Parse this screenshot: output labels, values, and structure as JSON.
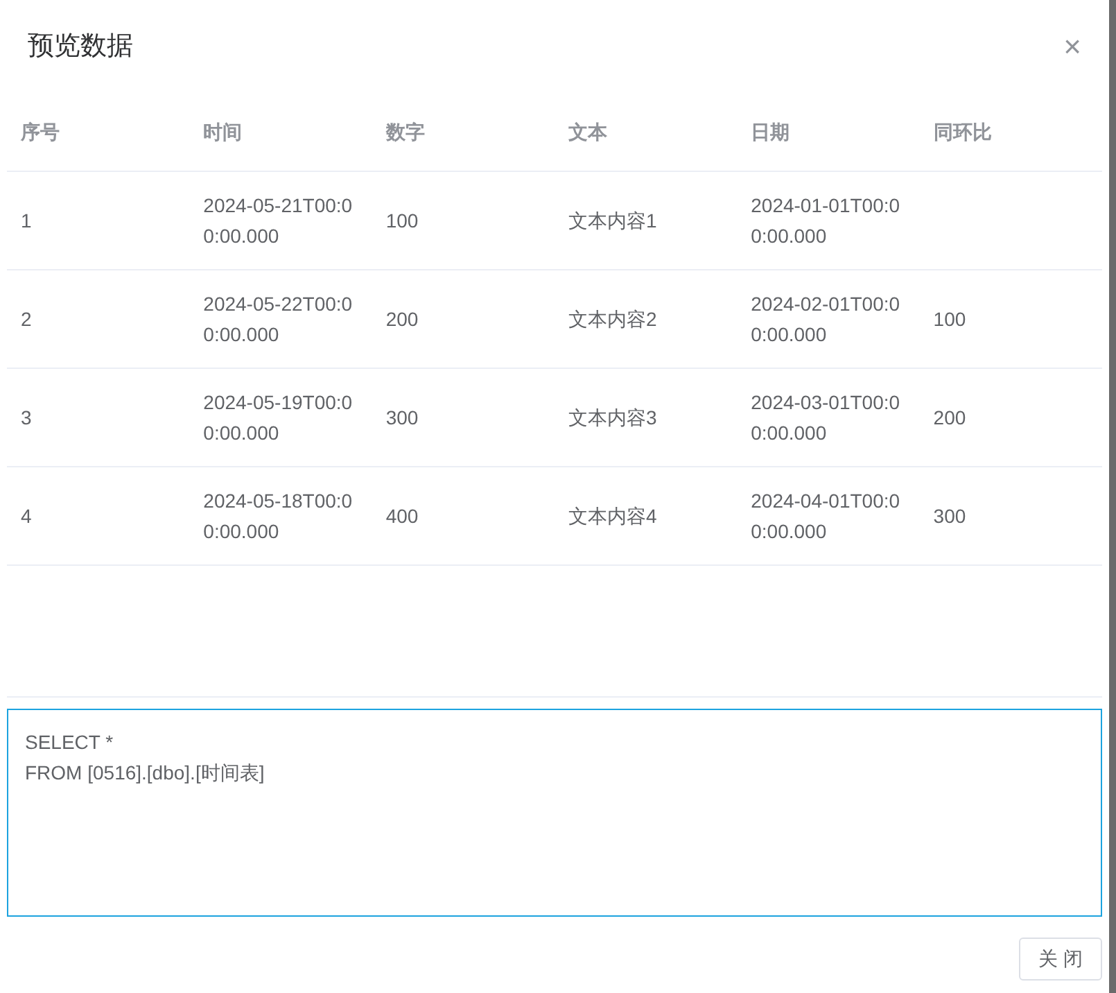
{
  "dialog": {
    "title": "预览数据",
    "close_icon": "×"
  },
  "table": {
    "columns": [
      "序号",
      "时间",
      "数字",
      "文本",
      "日期",
      "同环比"
    ],
    "rows": [
      [
        "1",
        "2024-05-21T00:00:00.000",
        "100",
        "文本内容1",
        "2024-01-01T00:00:00.000",
        null
      ],
      [
        "2",
        "2024-05-22T00:00:00.000",
        "200",
        "文本内容2",
        "2024-02-01T00:00:00.000",
        "100"
      ],
      [
        "3",
        "2024-05-19T00:00:00.000",
        "300",
        "文本内容3",
        "2024-03-01T00:00:00.000",
        "200"
      ],
      [
        "4",
        "2024-05-18T00:00:00.000",
        "400",
        "文本内容4",
        "2024-04-01T00:00:00.000",
        "300"
      ]
    ]
  },
  "sql": {
    "value": "SELECT *\nFROM [0516].[dbo].[时间表]"
  },
  "buttons": [
    "关 闭"
  ]
}
